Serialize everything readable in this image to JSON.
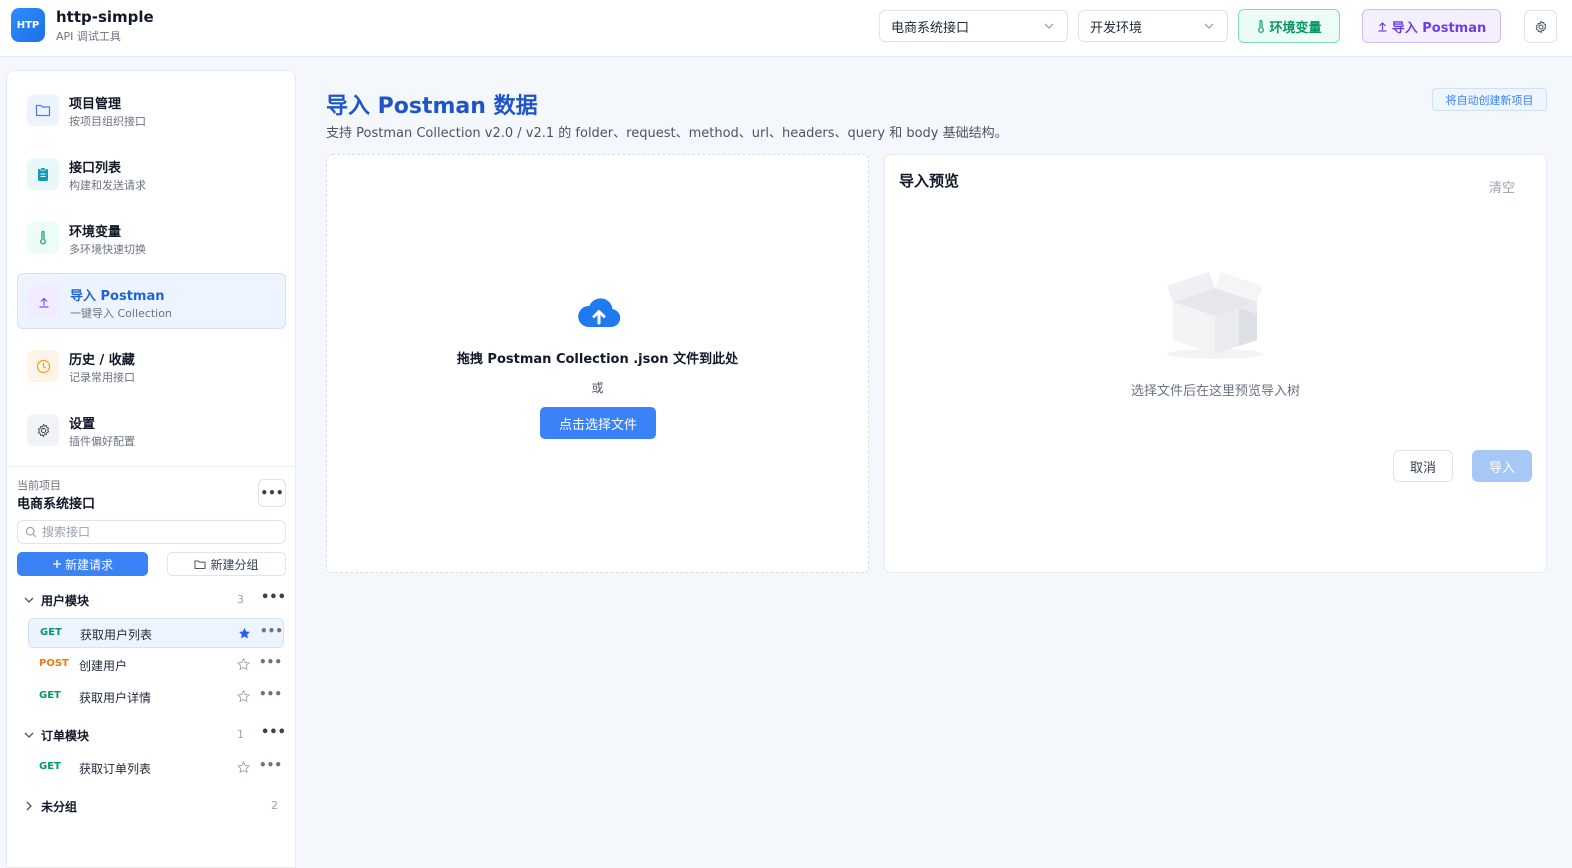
{
  "app": {
    "logo_text": "HTP",
    "name": "http-simple",
    "subtitle": "API 调试工具"
  },
  "header": {
    "project_select": "电商系统接口",
    "env_select": "开发环境",
    "env_button": "环境变量",
    "import_button": "导入 Postman",
    "env_button_icon": "thermometer-icon",
    "import_button_icon": "upload-icon",
    "settings_icon": "gear-icon"
  },
  "sidebar": {
    "nav": [
      {
        "label": "项目管理",
        "sub": "按项目组织接口",
        "icon": "folder-icon"
      },
      {
        "label": "接口列表",
        "sub": "构建和发送请求",
        "icon": "clipboard-icon"
      },
      {
        "label": "环境变量",
        "sub": "多环境快速切换",
        "icon": "thermometer-icon"
      },
      {
        "label": "导入 Postman",
        "sub": "一键导入 Collection",
        "icon": "upload-icon"
      },
      {
        "label": "历史 / 收藏",
        "sub": "记录常用接口",
        "icon": "clock-icon"
      },
      {
        "label": "设置",
        "sub": "插件偏好配置",
        "icon": "gear-icon"
      }
    ],
    "active_nav": "导入 Postman",
    "current_project_label": "当前项目",
    "current_project": "电商系统接口",
    "more": "•••",
    "search_placeholder": "搜索接口",
    "new_request": "新建请求",
    "new_group": "新建分组",
    "groups": [
      {
        "name": "用户模块",
        "count": "3",
        "expanded": true
      },
      {
        "name": "订单模块",
        "count": "1",
        "expanded": true
      },
      {
        "name": "未分组",
        "count": "2",
        "expanded": false
      }
    ],
    "requests": [
      {
        "method": "GET",
        "name": "获取用户列表",
        "starred": true,
        "active": true
      },
      {
        "method": "POST",
        "name": "创建用户",
        "starred": false
      },
      {
        "method": "GET",
        "name": "获取用户详情",
        "starred": false
      },
      {
        "method": "GET",
        "name": "获取订单列表",
        "starred": false
      }
    ]
  },
  "main": {
    "title": "导入 Postman 数据",
    "description": "支持 Postman Collection v2.0 / v2.1 的 folder、request、method、url、headers、query 和 body 基础结构。",
    "hint": "将自动创建新项目",
    "drop_text": "拖拽 Postman Collection .json 文件到此处",
    "or": "或",
    "pick_button": "点击选择文件",
    "preview_title": "导入预览",
    "clear": "清空",
    "empty_text": "选择文件后在这里预览导入树",
    "cancel": "取消",
    "import": "导入"
  },
  "colors": {
    "primary": "#3b82f6",
    "title_blue": "#1e56c8",
    "env_green": "#059669",
    "import_purple": "#6d3fe6",
    "post_orange": "#ea7a10"
  }
}
